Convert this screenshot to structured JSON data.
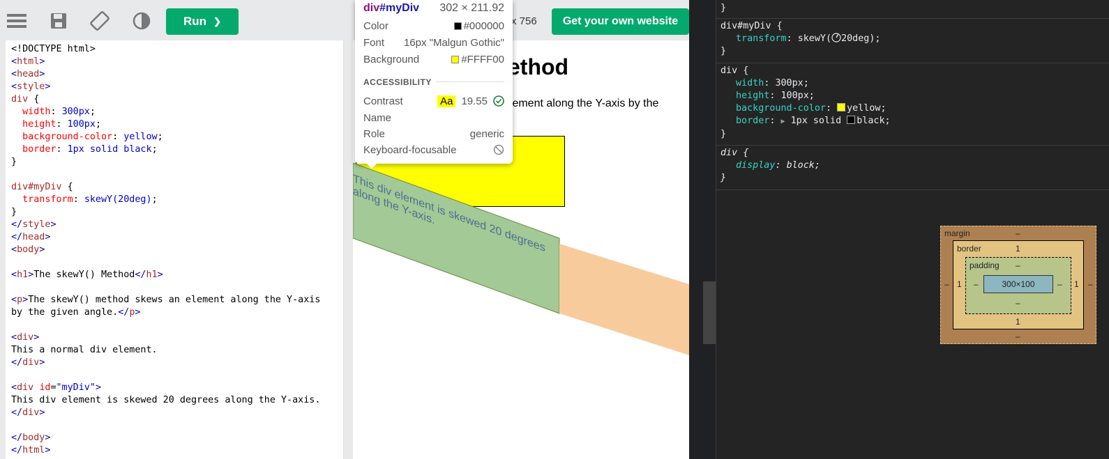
{
  "toolbar": {
    "run_label": "Run",
    "run_chevron": "❯",
    "dims_fragment": "x 756",
    "get_website_label": "Get your own website"
  },
  "editor": {
    "lines": [
      "<!DOCTYPE html>",
      "<html>",
      "<head>",
      "<style>",
      "div {",
      "  width: 300px;",
      "  height: 100px;",
      "  background-color: yellow;",
      "  border: 1px solid black;",
      "}",
      "",
      "div#myDiv {",
      "  transform: skewY(20deg);",
      "}",
      "</style>",
      "</head>",
      "<body>",
      "",
      "<h1>The skewY() Method</h1>",
      "",
      "<p>The skewY() method skews an element along the Y-axis",
      "by the given angle.</p>",
      "",
      "<div>",
      "This a normal div element.",
      "</div>",
      "",
      "<div id=\"myDiv\">",
      "This div element is skewed 20 degrees along the Y-axis.",
      "</div>",
      "",
      "</body>",
      "</html>"
    ]
  },
  "result": {
    "h1_visible": "ethod",
    "p_visible": "element along the Y-axis by the",
    "skewed_text": "This div element is skewed 20 degrees along the Y-axis."
  },
  "tooltip": {
    "selector_tag": "div",
    "selector_id": "#myDiv",
    "size": "302 × 211.92",
    "color_label": "Color",
    "color_value": "#000000",
    "font_label": "Font",
    "font_value": "16px \"Malgun Gothic\"",
    "background_label": "Background",
    "background_value": "#FFFF00",
    "accessibility_heading": "ACCESSIBILITY",
    "contrast_label": "Contrast",
    "contrast_sample": "Aa",
    "contrast_value": "19.55",
    "name_label": "Name",
    "role_label": "Role",
    "role_value": "generic",
    "keyboard_label": "Keyboard-focusable"
  },
  "devtools": {
    "rules": [
      {
        "selector": "div#myDiv {",
        "decls": [
          {
            "prop": "transform",
            "value": "skewY(",
            "value2": "20deg);"
          }
        ]
      },
      {
        "selector": "div {",
        "decls": [
          {
            "prop": "width",
            "value": "300px;"
          },
          {
            "prop": "height",
            "value": "100px;"
          },
          {
            "prop": "background-color",
            "value": "yellow;"
          },
          {
            "prop": "border",
            "value": "1px solid ",
            "value2": "black;"
          }
        ]
      },
      {
        "selector": "div {",
        "decls": [
          {
            "prop": "display",
            "value": "block;"
          }
        ]
      }
    ],
    "close_brace": "}",
    "box_model": {
      "margin_label": "margin",
      "margin_value": "–",
      "border_label": "border",
      "border_value": "1",
      "padding_label": "padding",
      "padding_value": "–",
      "content_size": "300×100"
    }
  },
  "colors": {
    "run_green": "#04aa6d",
    "yellow": "#ffff00",
    "skew_green": "#a2c996",
    "skew_orange": "#f8cb9c",
    "selector_purple": "#881280"
  }
}
